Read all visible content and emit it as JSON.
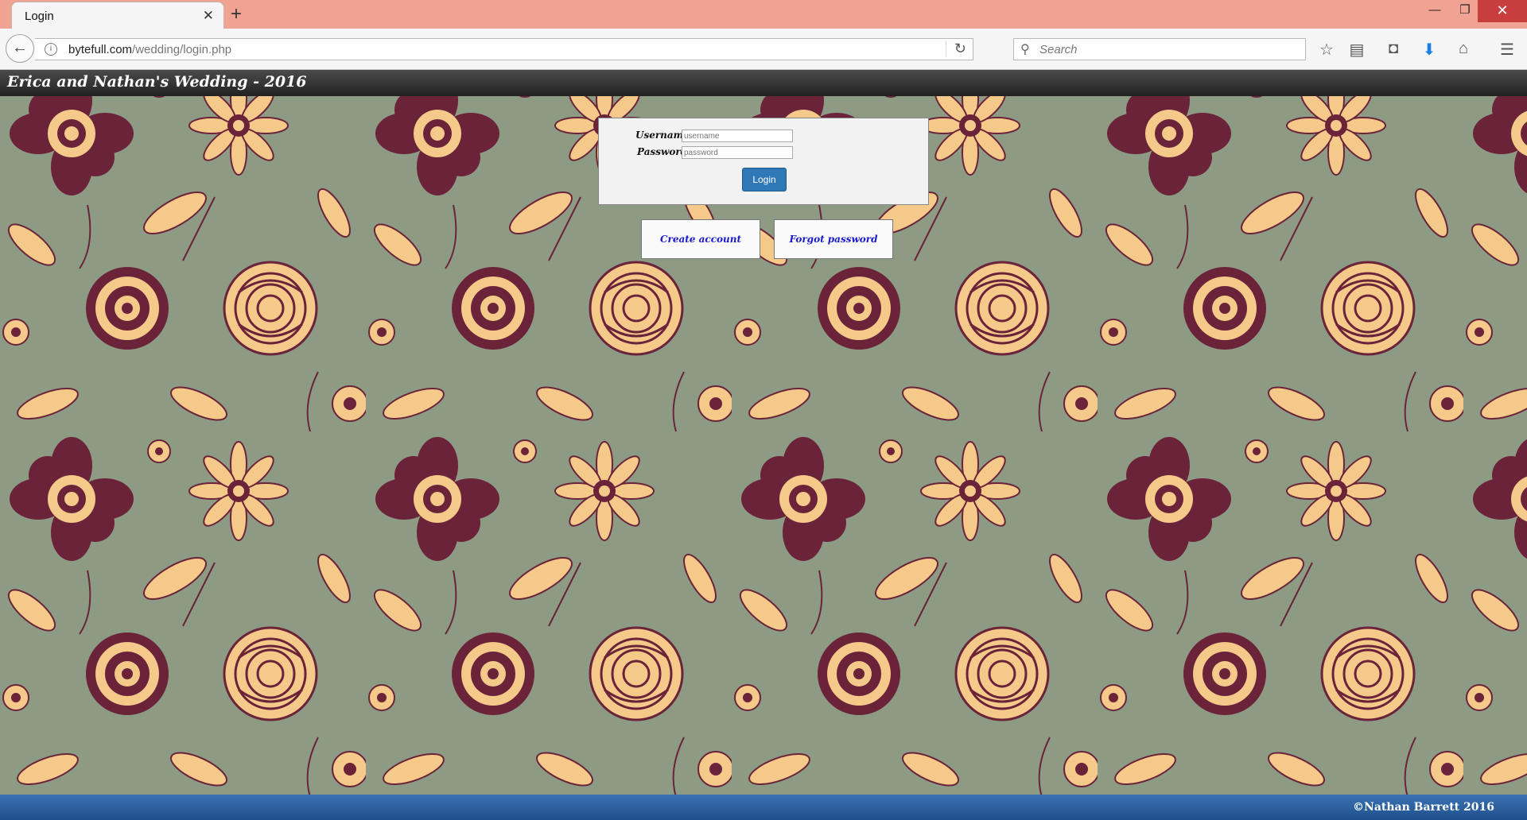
{
  "browser": {
    "tab_title": "Login",
    "tab_close": "✕",
    "new_tab": "+",
    "url_domain": "bytefull.com",
    "url_path": "/wedding/login.php",
    "search_placeholder": "Search",
    "window_controls": {
      "minimize": "—",
      "maximize": "❐",
      "close": "✕"
    }
  },
  "site": {
    "title": "Erica and Nathan's Wedding - 2016"
  },
  "login_form": {
    "username_label": "Username",
    "username_placeholder": "username",
    "password_label": "Password",
    "password_placeholder": "password",
    "login_button": "Login"
  },
  "links": {
    "create_account": "Create account",
    "forgot_password": "Forgot password"
  },
  "footer": {
    "copyright": "©Nathan Barrett 2016"
  },
  "colors": {
    "pattern_background": "#8d9b85",
    "flower_light": "#f4c98a",
    "flower_dark": "#6b2339",
    "header_bar": "#2f2f2f",
    "footer_bar": "#2a5f9e",
    "login_button": "#2f78b8",
    "link_text": "#1a1acc"
  }
}
